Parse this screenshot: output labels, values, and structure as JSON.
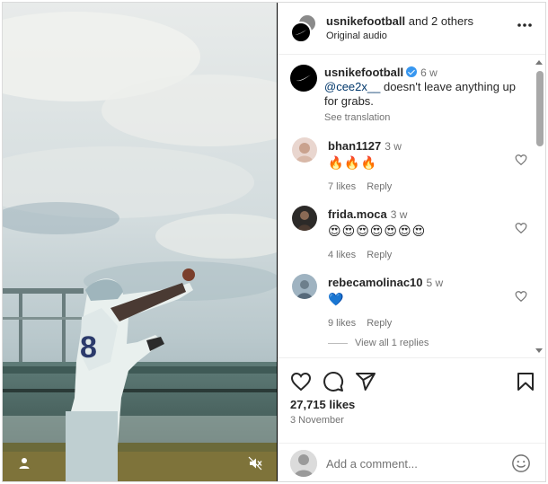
{
  "post": {
    "author": "usnikefootball",
    "collab_suffix": "and 2 others",
    "audio": "Original audio"
  },
  "caption": {
    "username": "usnikefootball",
    "time": "6 w",
    "mention": "@cee2x__",
    "text": " doesn't leave anything up for grabs.",
    "see_translation": "See translation"
  },
  "comments": [
    {
      "username": "bhan1127",
      "time": "3 w",
      "text": "🔥🔥🔥",
      "likes": "7 likes",
      "reply": "Reply"
    },
    {
      "username": "frida.moca",
      "time": "3 w",
      "text": "😍😍😍😍😍😍😍",
      "likes": "4 likes",
      "reply": "Reply"
    },
    {
      "username": "rebecamolinac10",
      "time": "5 w",
      "text": "💙",
      "likes": "9 likes",
      "reply": "Reply"
    }
  ],
  "view_replies": "View all 1 replies",
  "stats": {
    "likes": "27,715 likes",
    "date": "3 November"
  },
  "composer": {
    "placeholder": "Add a comment..."
  },
  "icons": {
    "header": [
      "nike-logo-icon",
      "more-options-icon"
    ],
    "actions": [
      "heart-icon",
      "comment-icon",
      "share-icon",
      "bookmark-icon"
    ],
    "media": [
      "user-tag-icon",
      "muted-icon"
    ],
    "composer": [
      "emoji-icon"
    ]
  },
  "colors": {
    "verified": "#3897f0",
    "mention": "#00376b",
    "muted_text": "#737373"
  }
}
